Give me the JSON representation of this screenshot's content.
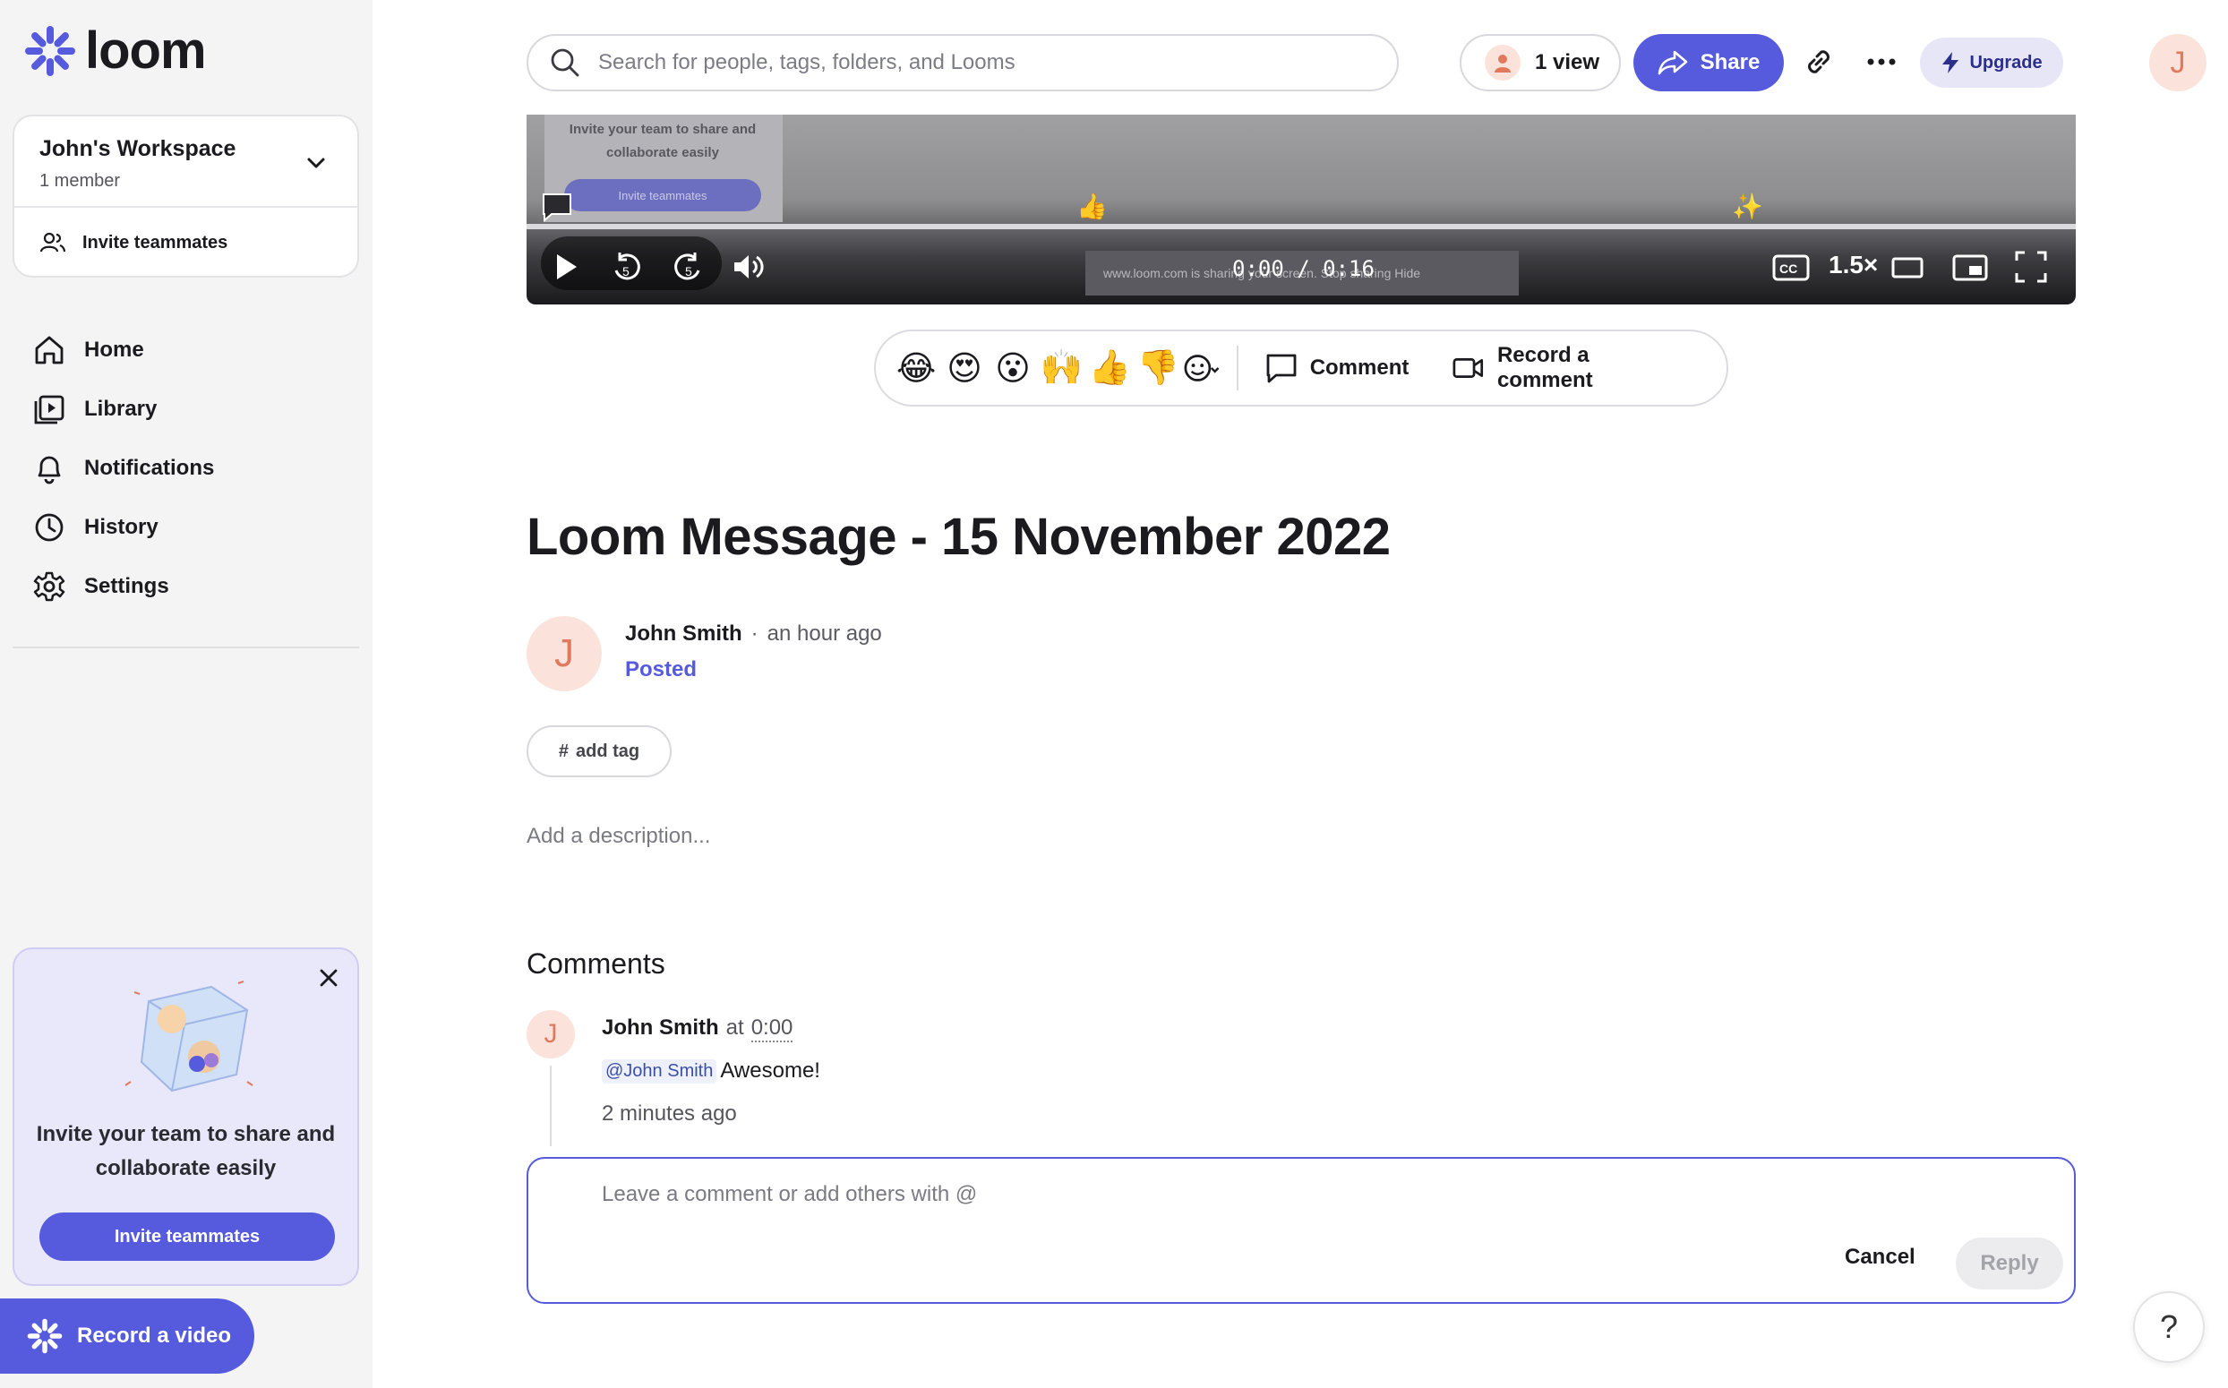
{
  "brand": {
    "name": "loom",
    "accent": "#565add"
  },
  "sidebar": {
    "workspace": {
      "name": "John's Workspace",
      "members": "1 member",
      "invite_label": "Invite teammates"
    },
    "nav": [
      {
        "label": "Home",
        "icon": "home-icon"
      },
      {
        "label": "Library",
        "icon": "library-icon"
      },
      {
        "label": "Notifications",
        "icon": "bell-icon"
      },
      {
        "label": "History",
        "icon": "clock-icon"
      },
      {
        "label": "Settings",
        "icon": "gear-icon"
      }
    ],
    "promo": {
      "text": "Invite your team to share and collaborate easily",
      "button": "Invite teammates"
    },
    "record_button": "Record a video"
  },
  "topbar": {
    "search_placeholder": "Search for people, tags, folders, and Looms",
    "views_label": "1 view",
    "share_label": "Share",
    "upgrade_label": "Upgrade",
    "user_initial": "J"
  },
  "video": {
    "panel_text": "Invite your team to share and collaborate easily",
    "panel_button": "Invite teammates",
    "time": "0:00 / 0:16",
    "speed": "1.5×",
    "banner_text": "www.loom.com is sharing your screen.   Stop sharing   Hide",
    "marker_emojis": [
      "👍",
      "✨"
    ]
  },
  "reactions": {
    "emojis": [
      "😂",
      "😍",
      "😮",
      "🙌",
      "👍",
      "👎"
    ],
    "comment_label": "Comment",
    "record_comment_label": "Record a comment"
  },
  "message": {
    "title": "Loom Message - 15 November 2022",
    "author": "John Smith",
    "author_initial": "J",
    "time": "an hour ago",
    "status": "Posted",
    "tag_label": "add tag",
    "description_placeholder": "Add a description..."
  },
  "comments": {
    "heading": "Comments",
    "items": [
      {
        "author": "John Smith",
        "at": "at",
        "timestamp": "0:00",
        "mention": "@John Smith",
        "text": "Awesome!",
        "age": "2 minutes ago",
        "initial": "J"
      }
    ],
    "input_placeholder": "Leave a comment or add others with @",
    "cancel_label": "Cancel",
    "reply_label": "Reply"
  },
  "help_label": "?"
}
